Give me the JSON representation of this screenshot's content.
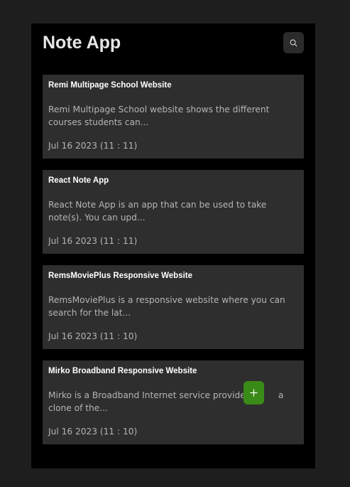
{
  "app": {
    "title": "Note App"
  },
  "header": {
    "search_icon": "search-icon"
  },
  "notes": [
    {
      "title": "Remi Multipage School Website",
      "excerpt": "Remi Multipage School website shows the different courses students can...",
      "date": "Jul 16 2023 (11 : 11)"
    },
    {
      "title": "React Note App",
      "excerpt": "React Note App is an app that can be used to take note(s). You can upd...",
      "date": "Jul 16 2023 (11 : 11)"
    },
    {
      "title": "RemsMoviePlus Responsive Website",
      "excerpt": "RemsMoviePlus is a responsive website where you can search for the lat...",
      "date": "Jul 16 2023 (11 : 10)"
    },
    {
      "title": "Mirko Broadband Responsive Website",
      "excerpt": "Mirko is a Broadband Internet service provider. T       a clone of the...",
      "date": "Jul 16 2023 (11 : 10)"
    }
  ],
  "fab": {
    "icon": "plus-icon"
  },
  "colors": {
    "page_background": "#1e1e1e",
    "app_background": "#000000",
    "card_background": "#2e2e2e",
    "fab_background": "#3a8a17",
    "title_text": "#e6e6e6",
    "muted_text": "#b5b5b5"
  }
}
